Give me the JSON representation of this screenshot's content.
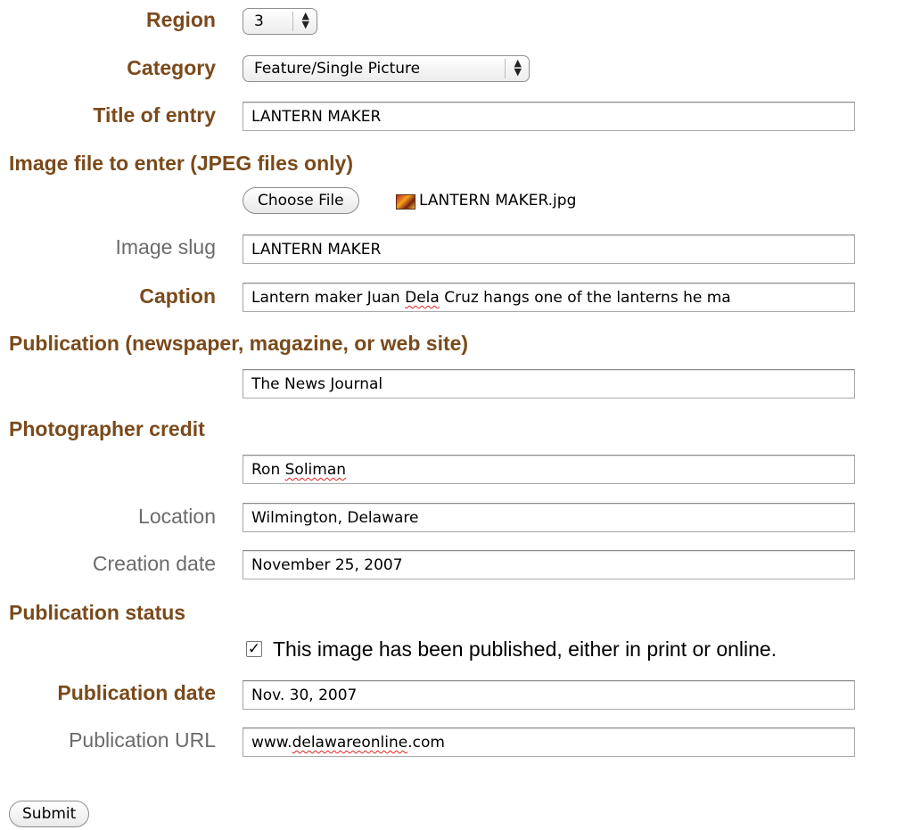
{
  "form": {
    "region": {
      "label": "Region",
      "value": "3"
    },
    "category": {
      "label": "Category",
      "value": "Feature/Single Picture"
    },
    "title": {
      "label": "Title of entry",
      "value": "LANTERN MAKER"
    },
    "image_file": {
      "label": "Image file to enter (JPEG files only)",
      "button_label": "Choose File",
      "file_name": "LANTERN MAKER.jpg",
      "thumbnail_icon": "image-thumbnail-icon"
    },
    "image_slug": {
      "label": "Image slug",
      "value": "LANTERN MAKER"
    },
    "caption": {
      "label": "Caption",
      "value_prefix": "Lantern maker Juan ",
      "value_misspelled": "Dela",
      "value_suffix": " Cruz hangs one of the lanterns he ma"
    },
    "publication": {
      "label": "Publication (newspaper, magazine, or web site)",
      "value": "The News Journal"
    },
    "photographer": {
      "label": "Photographer credit",
      "value_prefix": "Ron ",
      "value_misspelled": "Soliman"
    },
    "location": {
      "label": "Location",
      "value": "Wilmington, Delaware"
    },
    "creation_date": {
      "label": "Creation date",
      "value": "November 25, 2007"
    },
    "publication_status": {
      "label": "Publication status",
      "checked": true,
      "checkbox_label": "This image has been published, either in print or online."
    },
    "publication_date": {
      "label": "Publication date",
      "value": "Nov. 30, 2007"
    },
    "publication_url": {
      "label": "Publication URL",
      "value_prefix": "www.",
      "value_misspelled": "delawareonline",
      "value_suffix": ".com"
    },
    "submit_label": "Submit"
  },
  "colors": {
    "label_bold": "#7a4a1b",
    "label_plain": "#6b6b6b",
    "spellcheck": "#dd2222"
  }
}
